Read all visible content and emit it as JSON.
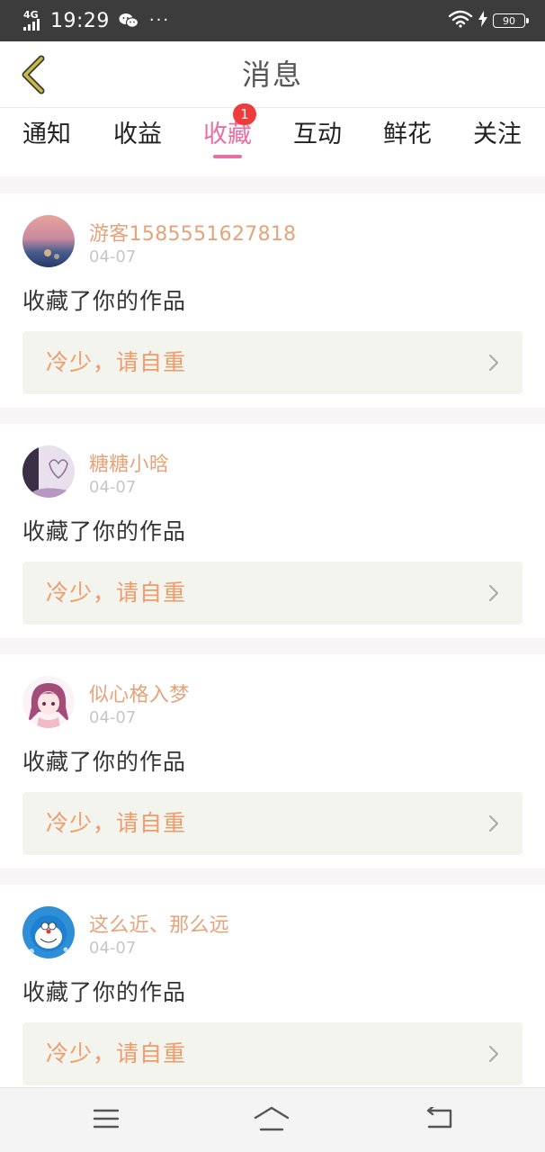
{
  "status_bar": {
    "network": "4G",
    "time": "19:29",
    "dots": "···",
    "battery": "90"
  },
  "header": {
    "title": "消息"
  },
  "tabs": [
    {
      "label": "通知"
    },
    {
      "label": "收益"
    },
    {
      "label": "收藏",
      "badge": "1",
      "active": true
    },
    {
      "label": "互动"
    },
    {
      "label": "鲜花"
    },
    {
      "label": "关注"
    }
  ],
  "messages": [
    {
      "username": "游客1585551627818",
      "date": "04-07",
      "action": "收藏了你的作品",
      "work_title": "冷少，请自重"
    },
    {
      "username": "糖糖小晗",
      "date": "04-07",
      "action": "收藏了你的作品",
      "work_title": "冷少，请自重"
    },
    {
      "username": "似心格入梦",
      "date": "04-07",
      "action": "收藏了你的作品",
      "work_title": "冷少，请自重"
    },
    {
      "username": "这么近、那么远",
      "date": "04-07",
      "action": "收藏了你的作品",
      "work_title": "冷少，请自重"
    }
  ],
  "colors": {
    "accent": "#e76fa4",
    "username": "#e6a37a",
    "work_title": "#ee9b6a",
    "badge": "#ee3b3b",
    "back_arrow": "#c9b84a"
  }
}
